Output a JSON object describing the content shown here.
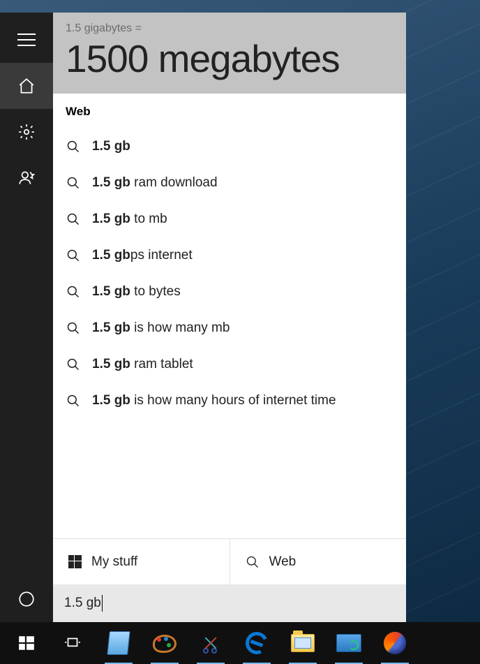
{
  "answer": {
    "query_line": "1.5 gigabytes =",
    "result": "1500 megabytes"
  },
  "web_section": {
    "heading": "Web",
    "suggestions": [
      {
        "bold": "1.5 gb",
        "rest": ""
      },
      {
        "bold": "1.5 gb",
        "rest": " ram download"
      },
      {
        "bold": "1.5 gb",
        "rest": " to mb"
      },
      {
        "bold": "1.5 gb",
        "rest": "ps internet"
      },
      {
        "bold": "1.5 gb",
        "rest": " to bytes"
      },
      {
        "bold": "1.5 gb",
        "rest": " is how many mb"
      },
      {
        "bold": "1.5 gb",
        "rest": " ram tablet"
      },
      {
        "bold": "1.5 gb",
        "rest": " is how many hours of internet time"
      }
    ]
  },
  "bottom": {
    "my_stuff": "My stuff",
    "web": "Web"
  },
  "search_input": {
    "value": "1.5 gb"
  },
  "sidebar": {
    "items": [
      "menu",
      "home",
      "settings",
      "feedback",
      "cortana"
    ]
  },
  "taskbar": {
    "items": [
      "start",
      "task-view",
      "notepad",
      "paint",
      "snipping-tool",
      "edge",
      "file-explorer",
      "control-panel",
      "firefox"
    ]
  }
}
